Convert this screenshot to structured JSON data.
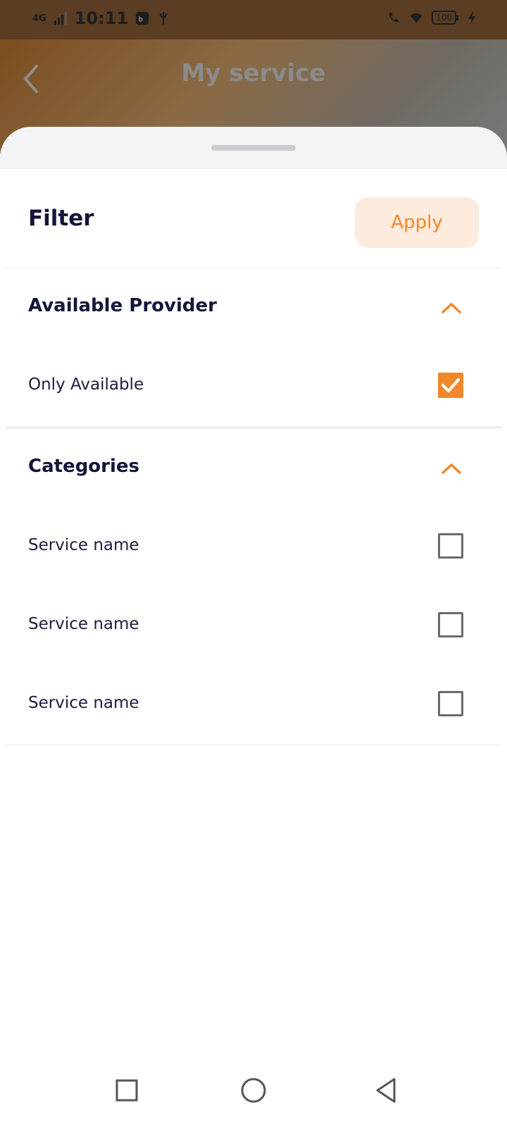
{
  "status_bar": {
    "network": "4G",
    "time": "10:11",
    "battery": "100"
  },
  "app_bar": {
    "title": "My service"
  },
  "filter": {
    "title": "Filter",
    "apply_label": "Apply",
    "sections": [
      {
        "title": "Available Provider",
        "options": [
          {
            "label": "Only Available",
            "checked": true
          }
        ]
      },
      {
        "title": "Categories",
        "options": [
          {
            "label": "Service name",
            "checked": false
          },
          {
            "label": "Service name",
            "checked": false
          },
          {
            "label": "Service name",
            "checked": false
          }
        ]
      }
    ]
  },
  "colors": {
    "accent": "#f0882b",
    "accent_light": "#fdebde",
    "title_text": "#13163a"
  },
  "icons": {
    "back": "chevron-left-icon",
    "collapse": "chevron-up-icon",
    "nav_recents": "square-icon",
    "nav_home": "circle-icon",
    "nav_back": "triangle-back-icon"
  }
}
